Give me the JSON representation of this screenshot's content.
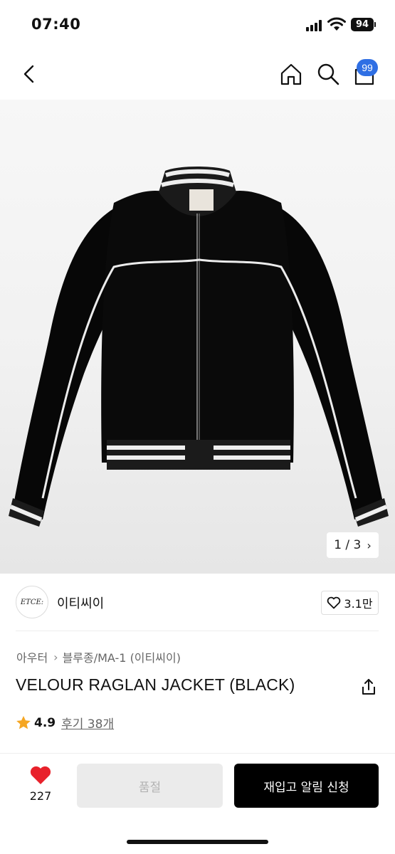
{
  "status_bar": {
    "time": "07:40",
    "battery": "94",
    "icons": [
      "signal-icon",
      "wifi-icon",
      "battery-icon"
    ]
  },
  "nav": {
    "icons": [
      "back-arrow-icon",
      "home-icon",
      "search-icon",
      "cart-icon"
    ],
    "cart_badge": "99",
    "badge_color": "#2f6fe4"
  },
  "gallery": {
    "counter": "1 / 3",
    "next_icon": "chevron-right-icon"
  },
  "brand": {
    "logo_text": "ETCE:",
    "name": "이티씨이",
    "likes": "3.1만",
    "like_icon": "heart-outline-icon"
  },
  "product": {
    "breadcrumb": [
      "아우터",
      "블루종/MA-1 (이티씨이)"
    ],
    "title": "VELOUR RAGLAN JACKET (BLACK)",
    "rating": "4.9",
    "reviews": "후기 38개",
    "rating_icon": "star-icon",
    "star_color": "#f5a623"
  },
  "bottom_bar": {
    "wish_count": "227",
    "wish_icon": "heart-filled-icon",
    "wish_color": "#e8212b",
    "soldout_label": "품절",
    "restock_label": "재입고 알림 신청"
  }
}
